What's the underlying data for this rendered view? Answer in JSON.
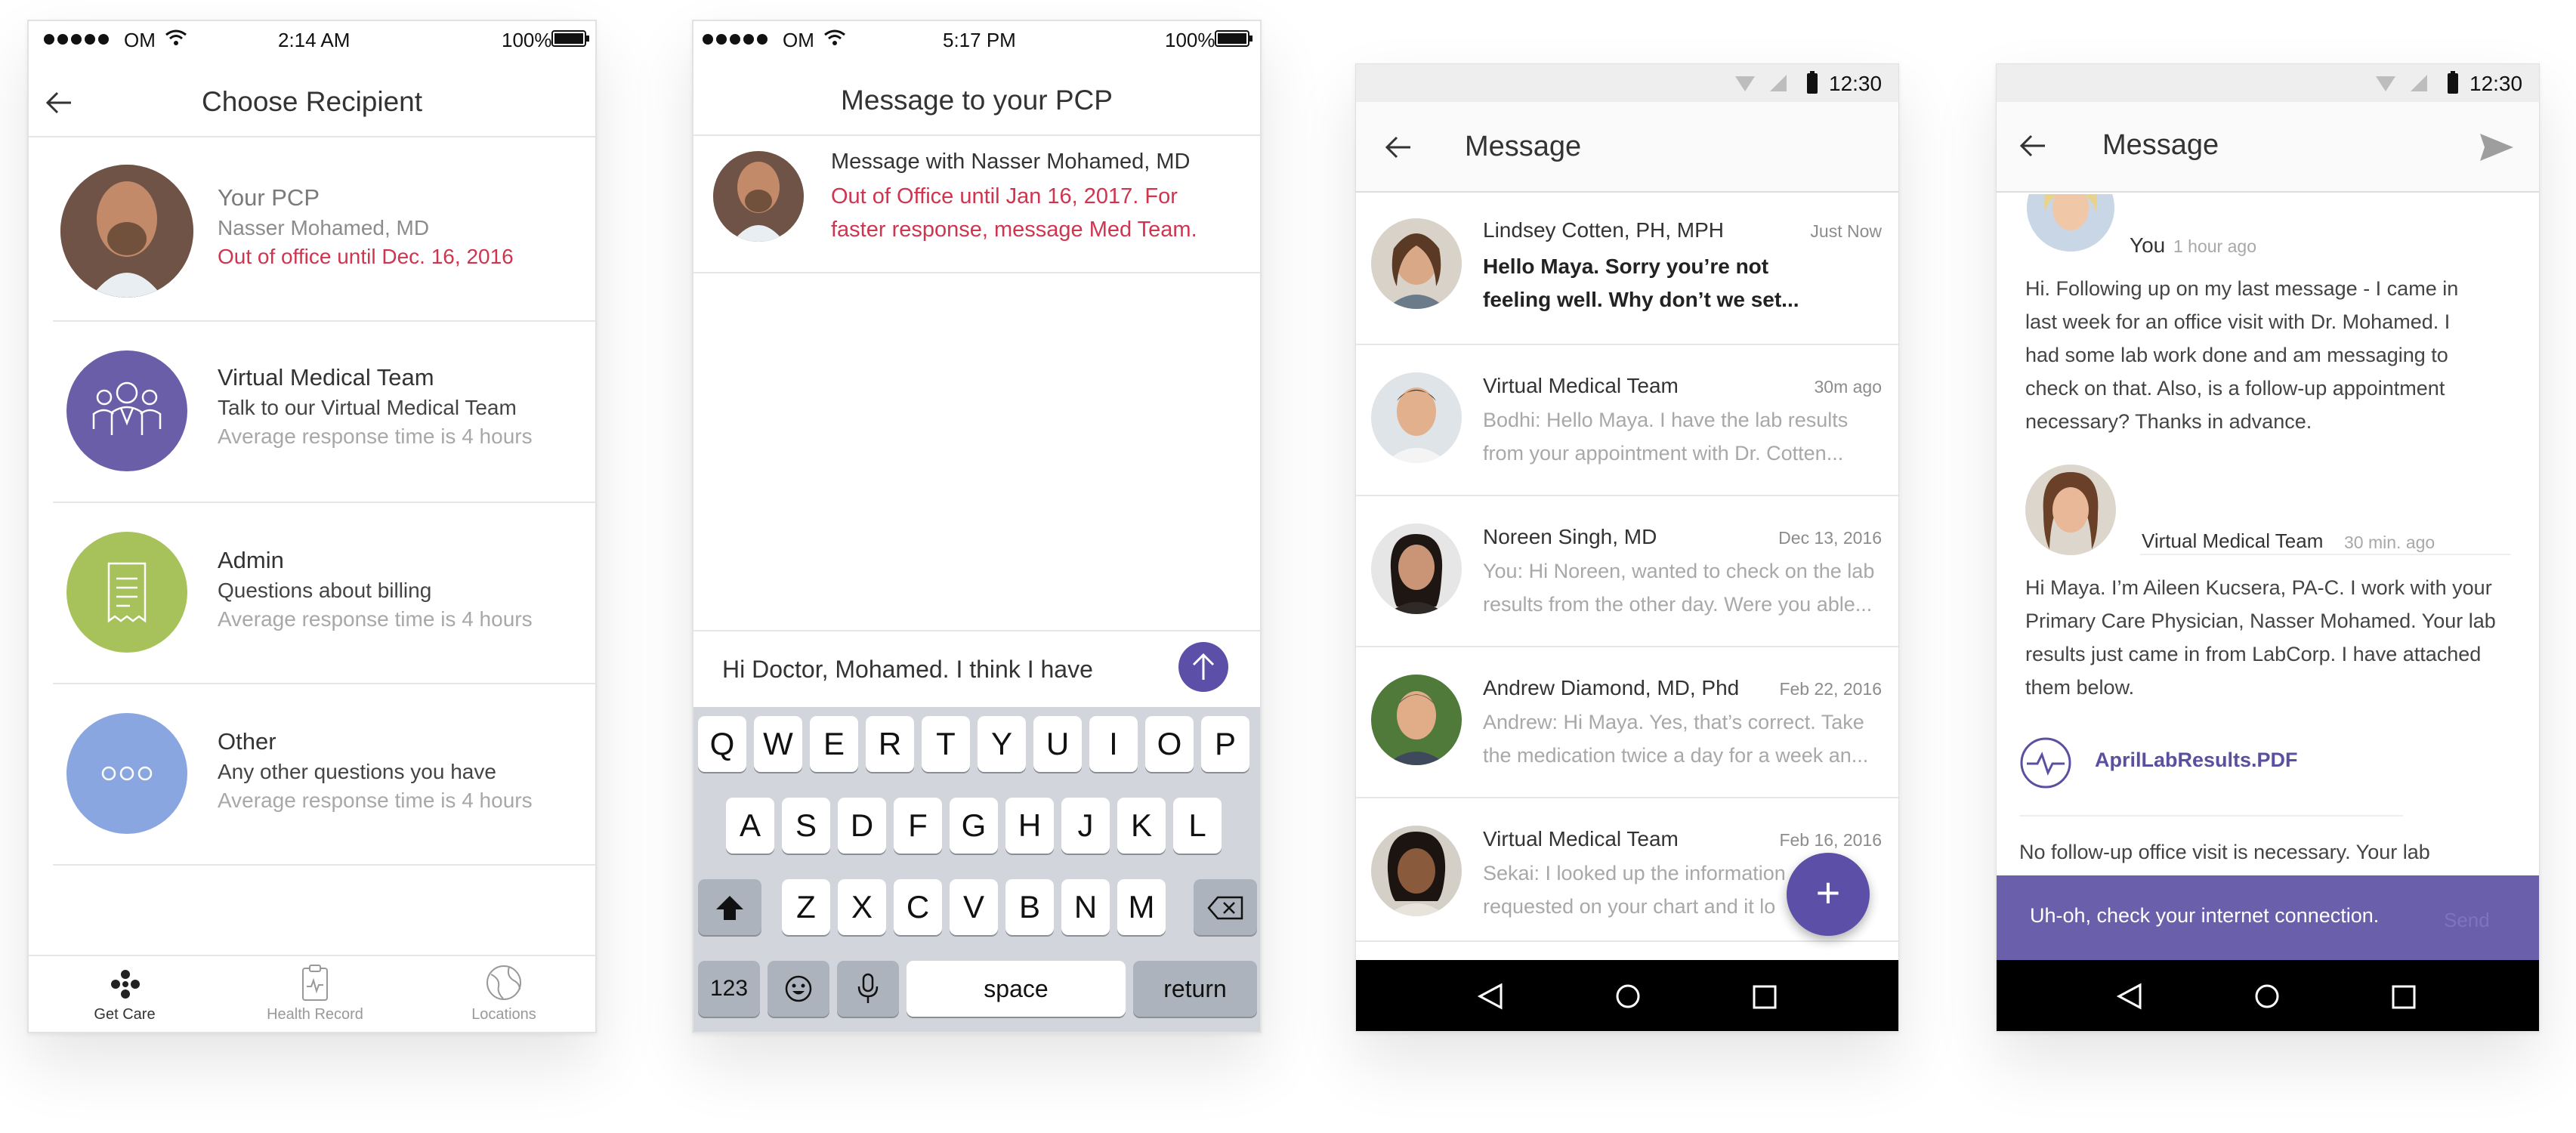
{
  "screen1": {
    "status": {
      "carrier": "OM",
      "time": "2:14 AM",
      "battery": "100%"
    },
    "title": "Choose Recipient",
    "items": [
      {
        "title": "Your PCP",
        "line2": "Nasser Mohamed, MD",
        "line3": "Out of office until Dec. 16, 2016"
      },
      {
        "title": "Virtual Medical Team",
        "line2": "Talk to our Virtual Medical Team",
        "line3": "Average response time is 4 hours"
      },
      {
        "title": "Admin",
        "line2": "Questions about billing",
        "line3": "Average response time is 4 hours"
      },
      {
        "title": "Other",
        "line2": "Any other questions you have",
        "line3": "Average response time is 4 hours"
      }
    ],
    "tabs": [
      {
        "label": "Get Care"
      },
      {
        "label": "Health Record"
      },
      {
        "label": "Locations"
      }
    ],
    "colors": {
      "team": "#6b5ea8",
      "admin": "#a7c25a",
      "other": "#8aa6e0",
      "alert": "#d0344f"
    }
  },
  "screen2": {
    "status": {
      "carrier": "OM",
      "time": "5:17 PM",
      "battery": "100%"
    },
    "title": "Message to your PCP",
    "header_line1": "Message with Nasser Mohamed, MD",
    "header_line2": "Out of Office until Jan 16, 2017. For",
    "header_line3": "faster response, message Med Team.",
    "input_value": "Hi Doctor, Mohamed. I think I have",
    "keyboard": {
      "row1": [
        "Q",
        "W",
        "E",
        "R",
        "T",
        "Y",
        "U",
        "I",
        "O",
        "P"
      ],
      "row2": [
        "A",
        "S",
        "D",
        "F",
        "G",
        "H",
        "J",
        "K",
        "L"
      ],
      "row3": [
        "Z",
        "X",
        "C",
        "V",
        "B",
        "N",
        "M"
      ],
      "numbers": "123",
      "space": "space",
      "return": "return"
    }
  },
  "screen3": {
    "status": {
      "time": "12:30"
    },
    "title": "Message",
    "threads": [
      {
        "name": "Lindsey Cotten, PH, MPH",
        "time": "Just Now",
        "line1": "Hello Maya. Sorry you’re not",
        "line2": "feeling well. Why don’t we set..."
      },
      {
        "name": "Virtual Medical Team",
        "time": "30m ago",
        "line1": "Bodhi: Hello Maya. I have the lab results",
        "line2": "from your appointment with Dr. Cotten..."
      },
      {
        "name": "Noreen Singh, MD",
        "time": "Dec 13, 2016",
        "line1": "You: Hi Noreen, wanted to check on the lab",
        "line2": "results from the other day. Were you able..."
      },
      {
        "name": "Andrew Diamond, MD, Phd",
        "time": "Feb 22, 2016",
        "line1": "Andrew: Hi Maya. Yes, that’s correct. Take",
        "line2": "the medication twice a day for a week an..."
      },
      {
        "name": "Virtual Medical Team",
        "time": "Feb 16, 2016",
        "line1": "Sekai: I looked up the information",
        "line2": "requested on your chart and it lo"
      }
    ],
    "fab_label": "+"
  },
  "screen4": {
    "status": {
      "time": "12:30"
    },
    "title": "Message",
    "msg1": {
      "sender": "You",
      "time": "1 hour ago",
      "lines": [
        "Hi. Following up on my last message - I came in",
        "last week for an office visit with Dr. Mohamed. I",
        "had some lab work done and am messaging to",
        "check on that. Also, is a follow-up appointment",
        "necessary? Thanks in advance."
      ]
    },
    "msg2": {
      "sender": "Virtual Medical Team",
      "time": "30 min. ago",
      "lines": [
        "Hi Maya. I’m Aileen Kucsera, PA-C. I work with your",
        "Primary Care Physician, Nasser Mohamed. Your lab",
        "results just came in from LabCorp. I have attached",
        "them below."
      ]
    },
    "attachment": "AprilLabResults.PDF",
    "msg3_line": "No follow-up office visit is necessary. Your lab",
    "snackbar": "Uh-oh, check your internet connection.",
    "snackbar_action": "Send"
  }
}
